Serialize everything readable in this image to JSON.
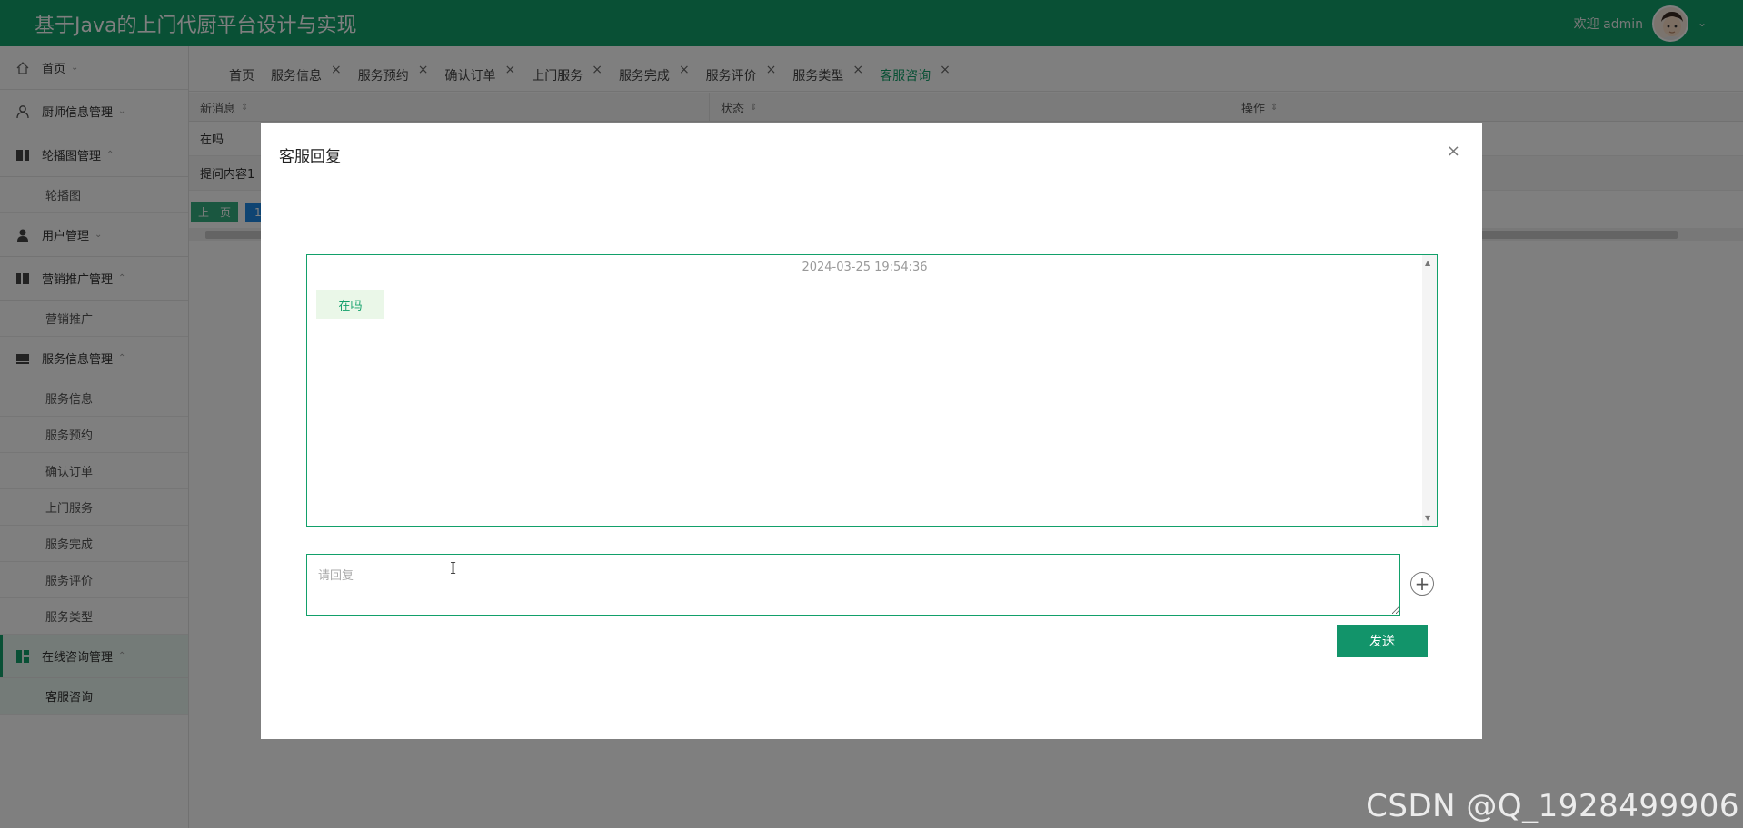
{
  "header": {
    "app_title": "基于Java的上门代厨平台设计与实现",
    "welcome": "欢迎 admin",
    "user_caret": "⌄"
  },
  "sidebar": {
    "items": [
      {
        "label": "首页",
        "icon": "home-icon",
        "expanded": false
      },
      {
        "label": "厨师信息管理",
        "icon": "user-icon",
        "expanded": false
      },
      {
        "label": "轮播图管理",
        "icon": "columns-icon",
        "expanded": true,
        "children": [
          "轮播图"
        ]
      },
      {
        "label": "用户管理",
        "icon": "person-icon",
        "expanded": false
      },
      {
        "label": "营销推广管理",
        "icon": "columns-icon",
        "expanded": true,
        "children": [
          "营销推广"
        ]
      },
      {
        "label": "服务信息管理",
        "icon": "layout-icon",
        "expanded": true,
        "children": [
          "服务信息",
          "服务预约",
          "确认订单",
          "上门服务",
          "服务完成",
          "服务评价",
          "服务类型"
        ]
      },
      {
        "label": "在线咨询管理",
        "icon": "dashboard-icon",
        "expanded": true,
        "active": true,
        "children": [
          "客服咨询"
        ]
      }
    ],
    "arrow_down": "⌄",
    "arrow_up": "⌃"
  },
  "tabs": [
    {
      "label": "首页",
      "closable": false
    },
    {
      "label": "服务信息",
      "closable": true
    },
    {
      "label": "服务预约",
      "closable": true
    },
    {
      "label": "确认订单",
      "closable": true
    },
    {
      "label": "上门服务",
      "closable": true
    },
    {
      "label": "服务完成",
      "closable": true
    },
    {
      "label": "服务评价",
      "closable": true
    },
    {
      "label": "服务类型",
      "closable": true
    },
    {
      "label": "客服咨询",
      "closable": true,
      "active": true
    }
  ],
  "table": {
    "columns": [
      "新消息",
      "状态",
      "操作"
    ],
    "rows": [
      "在吗",
      "提问内容1"
    ],
    "pager": {
      "prev": "上一页",
      "page": "1"
    }
  },
  "modal": {
    "title": "客服回复",
    "close": "×",
    "timestamp": "2024-03-25 19:54:36",
    "message": "在吗",
    "reply_placeholder": "请回复",
    "add_symbol": "+",
    "send_label": "发送"
  },
  "watermark": "CSDN @Q_1928499906",
  "colors": {
    "brand": "#12a06a",
    "send": "#12946a",
    "pager_active": "#1e88e5"
  }
}
